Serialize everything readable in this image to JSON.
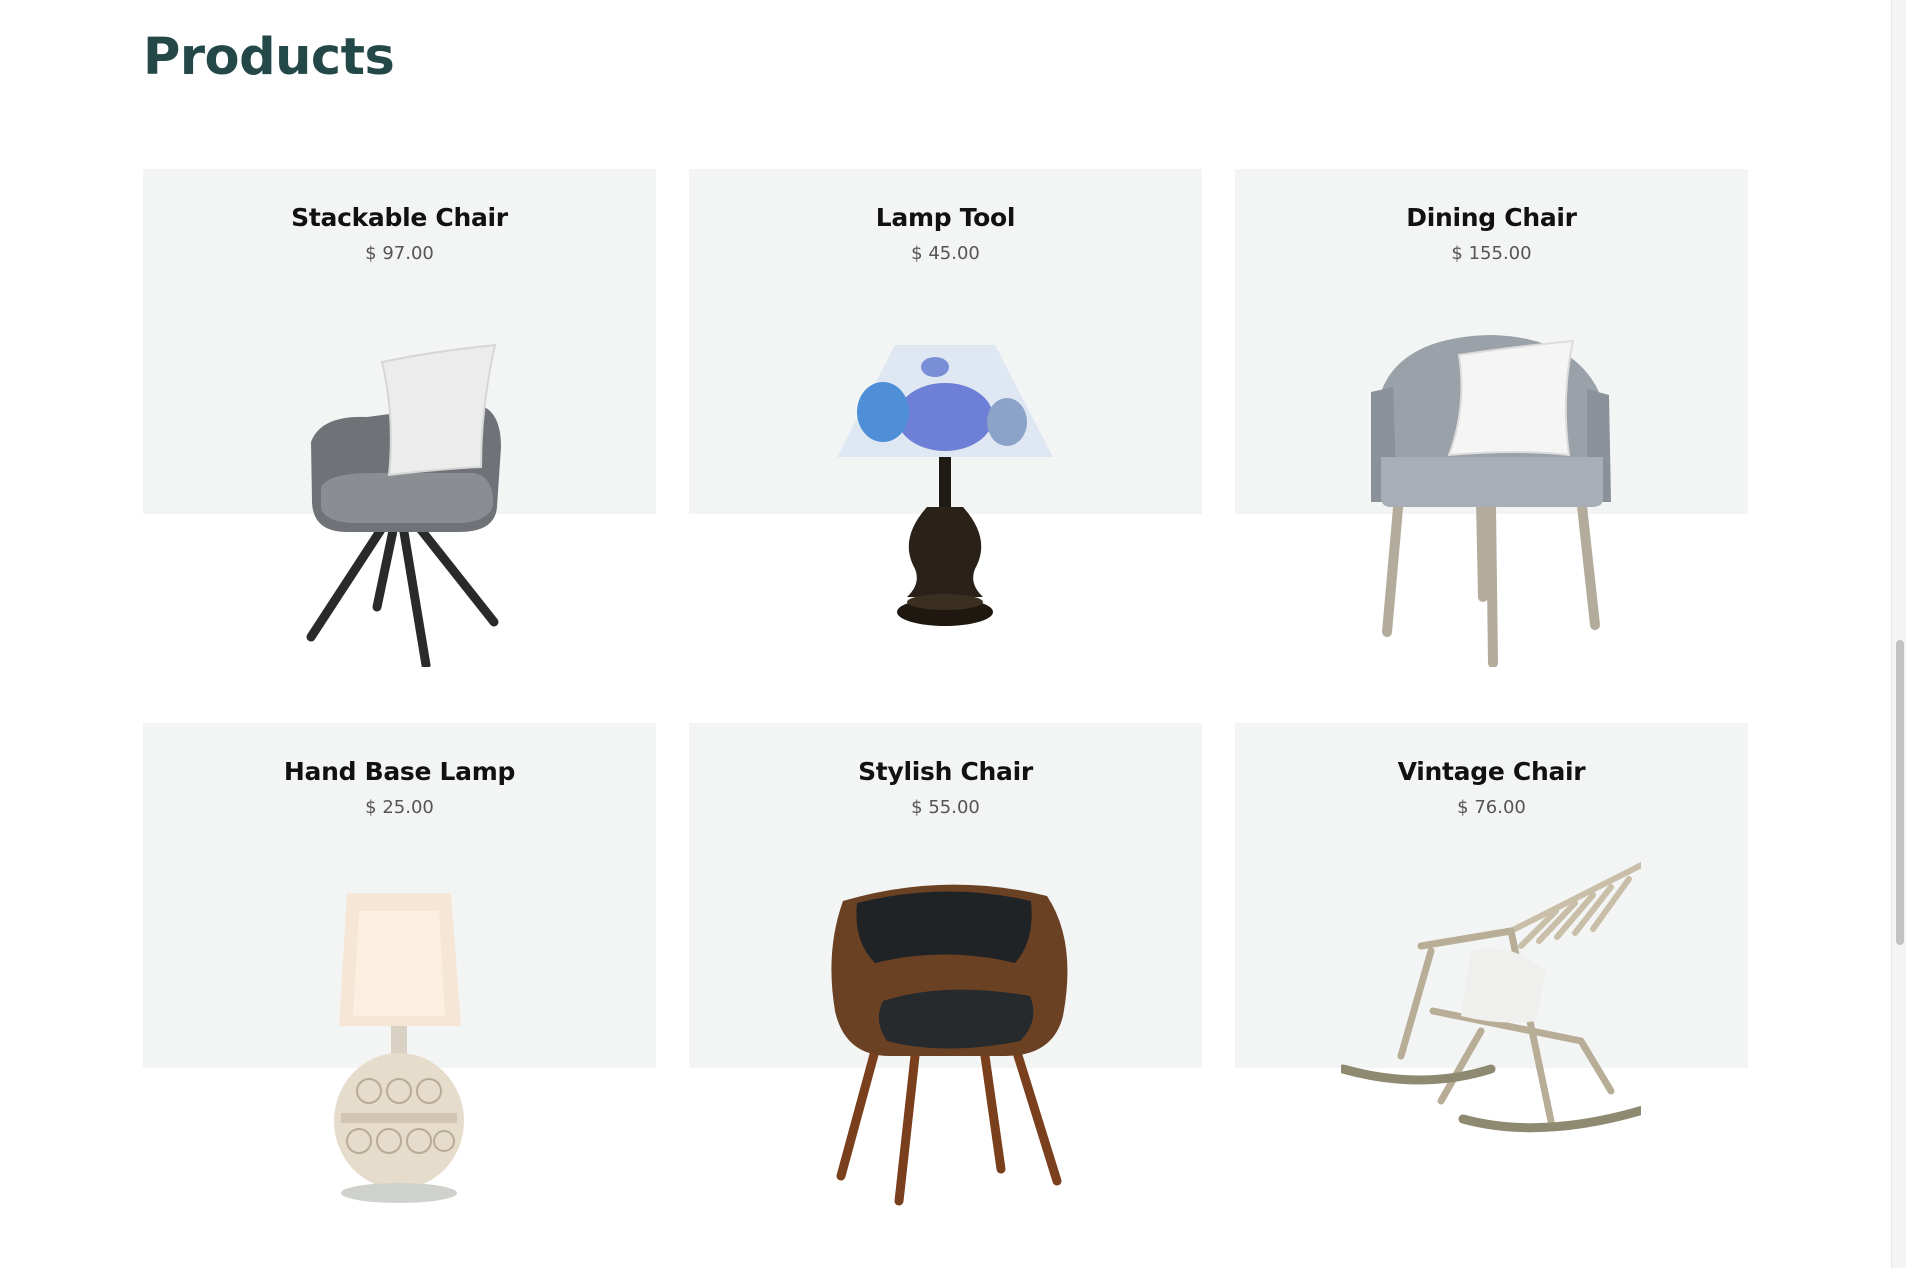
{
  "page": {
    "title": "Products"
  },
  "products": [
    {
      "name": "Stackable Chair",
      "price": "$ 97.00",
      "icon": "stackable-chair-image"
    },
    {
      "name": "Lamp Tool",
      "price": "$ 45.00",
      "icon": "lamp-tool-image"
    },
    {
      "name": "Dining Chair",
      "price": "$ 155.00",
      "icon": "dining-chair-image"
    },
    {
      "name": "Hand Base Lamp",
      "price": "$ 25.00",
      "icon": "hand-base-lamp-image"
    },
    {
      "name": "Stylish Chair",
      "price": "$ 55.00",
      "icon": "stylish-chair-image"
    },
    {
      "name": "Vintage Chair",
      "price": "$ 76.00",
      "icon": "vintage-chair-image"
    }
  ],
  "colors": {
    "title": "#244848",
    "card_bg": "#f3f5f4",
    "page_bg": "#ffffff"
  }
}
